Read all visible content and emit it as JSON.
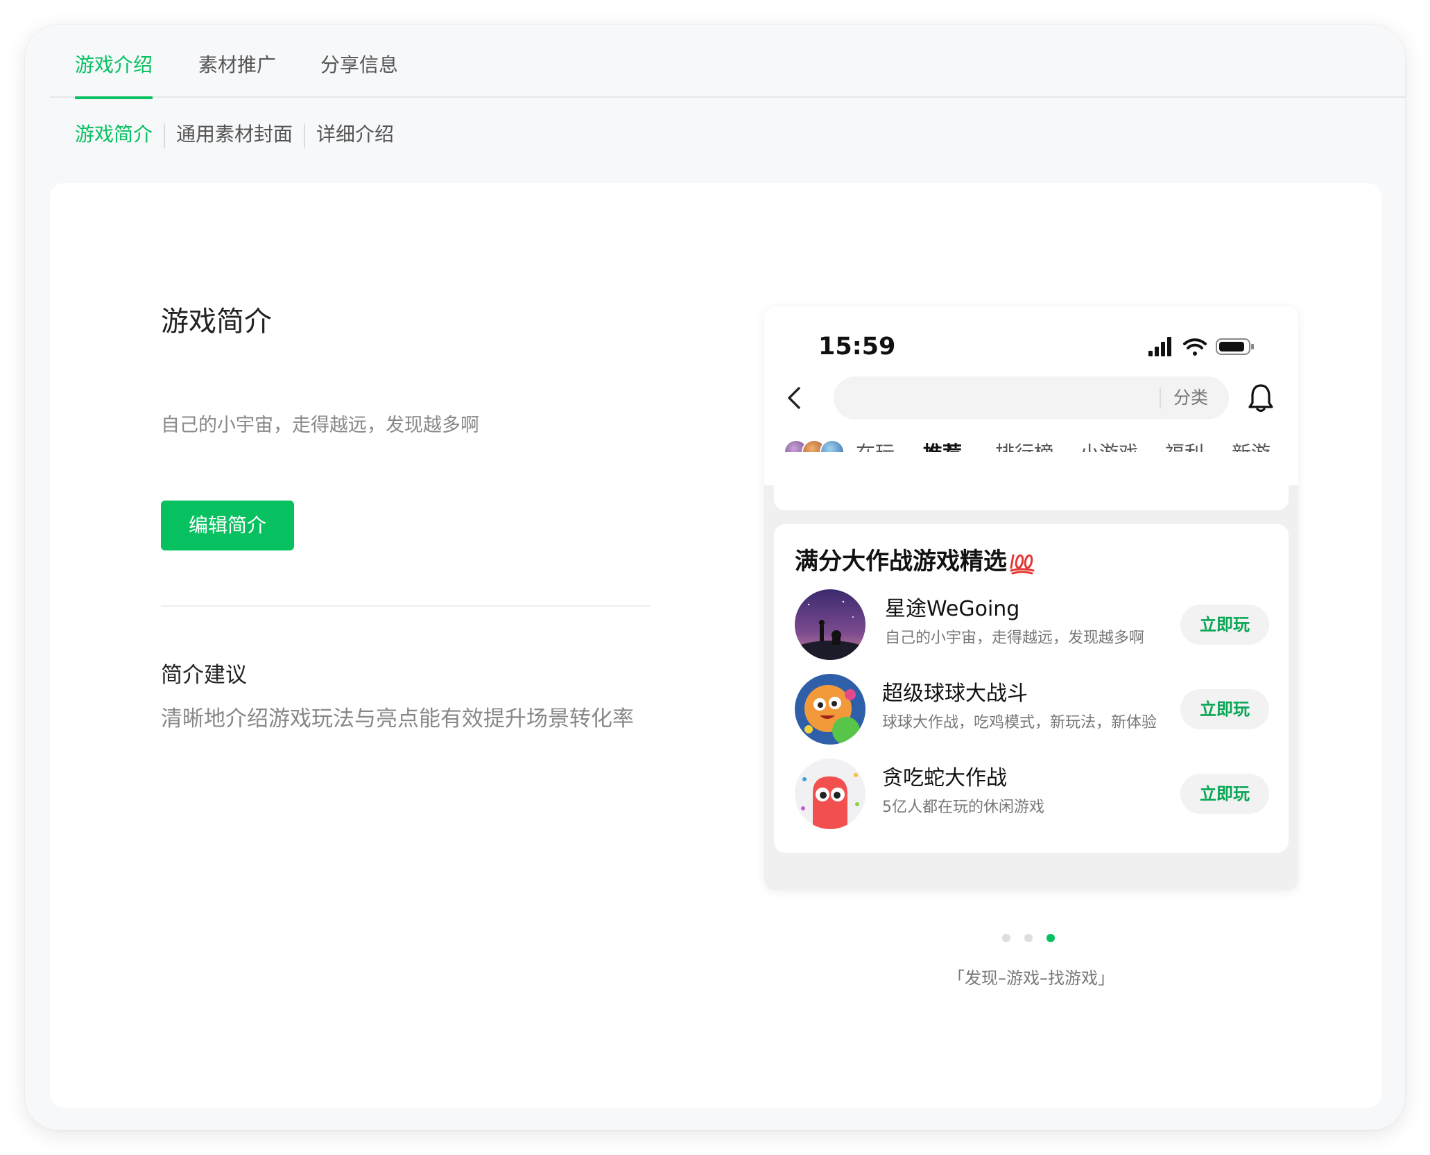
{
  "top_tabs": [
    "游戏介绍",
    "素材推广",
    "分享信息"
  ],
  "sub_tabs": [
    "游戏简介",
    "通用素材封面",
    "详细介绍"
  ],
  "intro": {
    "title": "游戏简介",
    "text": "自己的小宇宙，走得越远，发现越多啊",
    "edit_button": "编辑简介"
  },
  "suggestion": {
    "title": "简介建议",
    "text": "清晰地介绍游戏玩法与亮点能有效提升场景转化率"
  },
  "phone": {
    "time": "15:59",
    "search_category": "分类",
    "tabs": [
      "在玩",
      "推荐",
      "排行榜",
      "小游戏",
      "福利",
      "新游"
    ],
    "active_tab": "推荐",
    "card_title": "满分大作战游戏精选",
    "games": [
      {
        "name": "星途WeGoing",
        "desc": "自己的小宇宙，走得越远，发现越多啊",
        "button": "立即玩"
      },
      {
        "name": "超级球球大战斗",
        "desc": "球球大作战，吃鸡模式，新玩法，新体验",
        "button": "立即玩"
      },
      {
        "name": "贪吃蛇大作战",
        "desc": "5亿人都在玩的休闲游戏",
        "button": "立即玩"
      }
    ]
  },
  "carousel": {
    "count": 3,
    "active_index": 2
  },
  "caption": "「发现–游戏–找游戏」",
  "colors": {
    "accent": "#07c160",
    "play_text": "#07a554"
  }
}
